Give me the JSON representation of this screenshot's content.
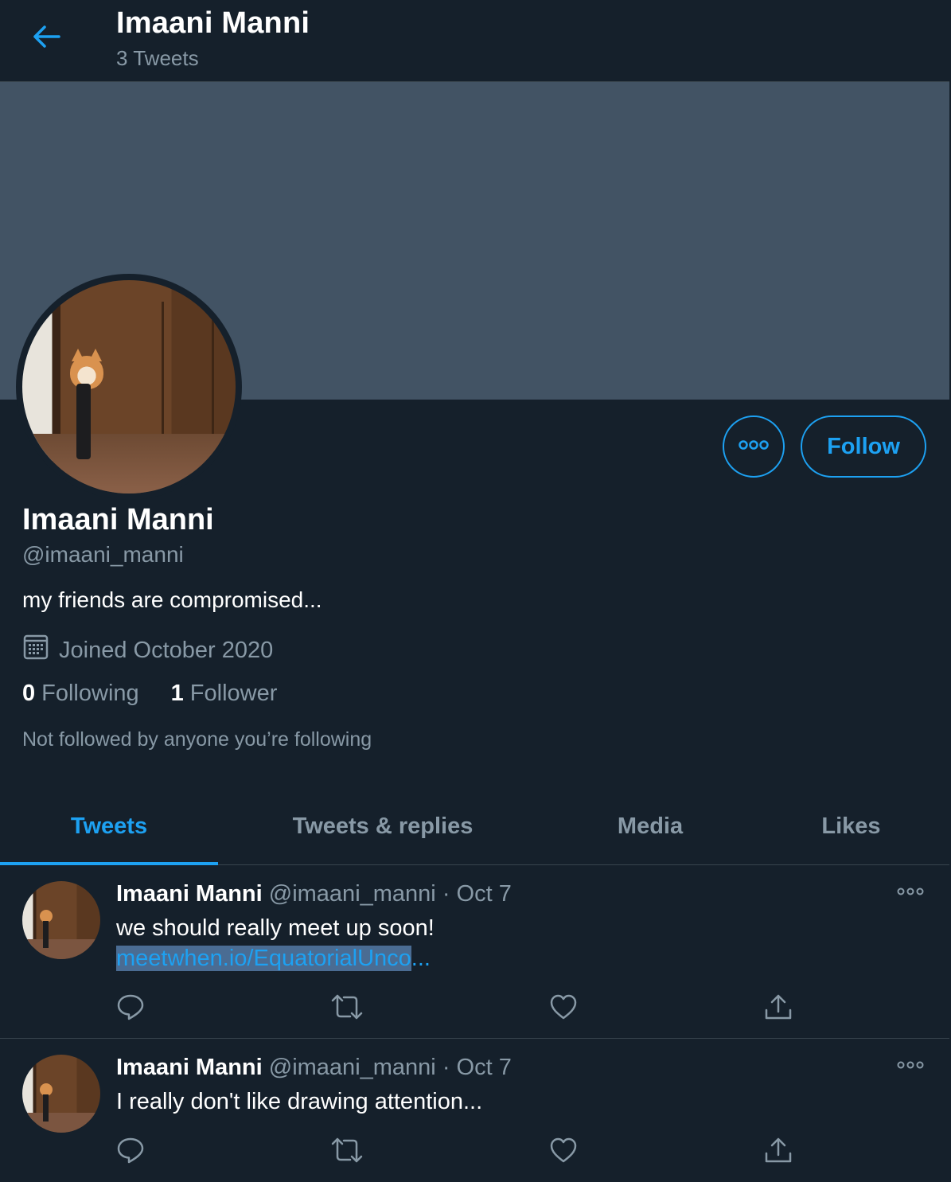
{
  "header": {
    "name": "Imaani Manni",
    "tweet_count": "3 Tweets",
    "back_icon": "arrow-left-icon"
  },
  "profile": {
    "name": "Imaani Manni",
    "handle": "@imaani_manni",
    "bio": "my friends are compromised...",
    "joined": "Joined October 2020",
    "following_count": "0",
    "following_label": "Following",
    "followers_count": "1",
    "followers_label": "Follower",
    "not_followed": "Not followed by anyone you’re following",
    "follow_button": "Follow"
  },
  "tabs": [
    {
      "label": "Tweets",
      "active": true
    },
    {
      "label": "Tweets & replies",
      "active": false
    },
    {
      "label": "Media",
      "active": false
    },
    {
      "label": "Likes",
      "active": false
    }
  ],
  "tweets": [
    {
      "name": "Imaani Manni",
      "handle": "@imaani_manni",
      "date": "Oct 7",
      "separator": "·",
      "text": "we should really meet up soon!",
      "link_selected": "meetwhen.io/EquatorialUnco",
      "link_rest": "..."
    },
    {
      "name": "Imaani Manni",
      "handle": "@imaani_manni",
      "date": "Oct 7",
      "separator": "·",
      "text": "I really don't like drawing attention..."
    }
  ],
  "colors": {
    "background": "#15202b",
    "banner": "#425364",
    "accent": "#1da1f2",
    "muted": "#8899a6",
    "border": "#38444d"
  }
}
